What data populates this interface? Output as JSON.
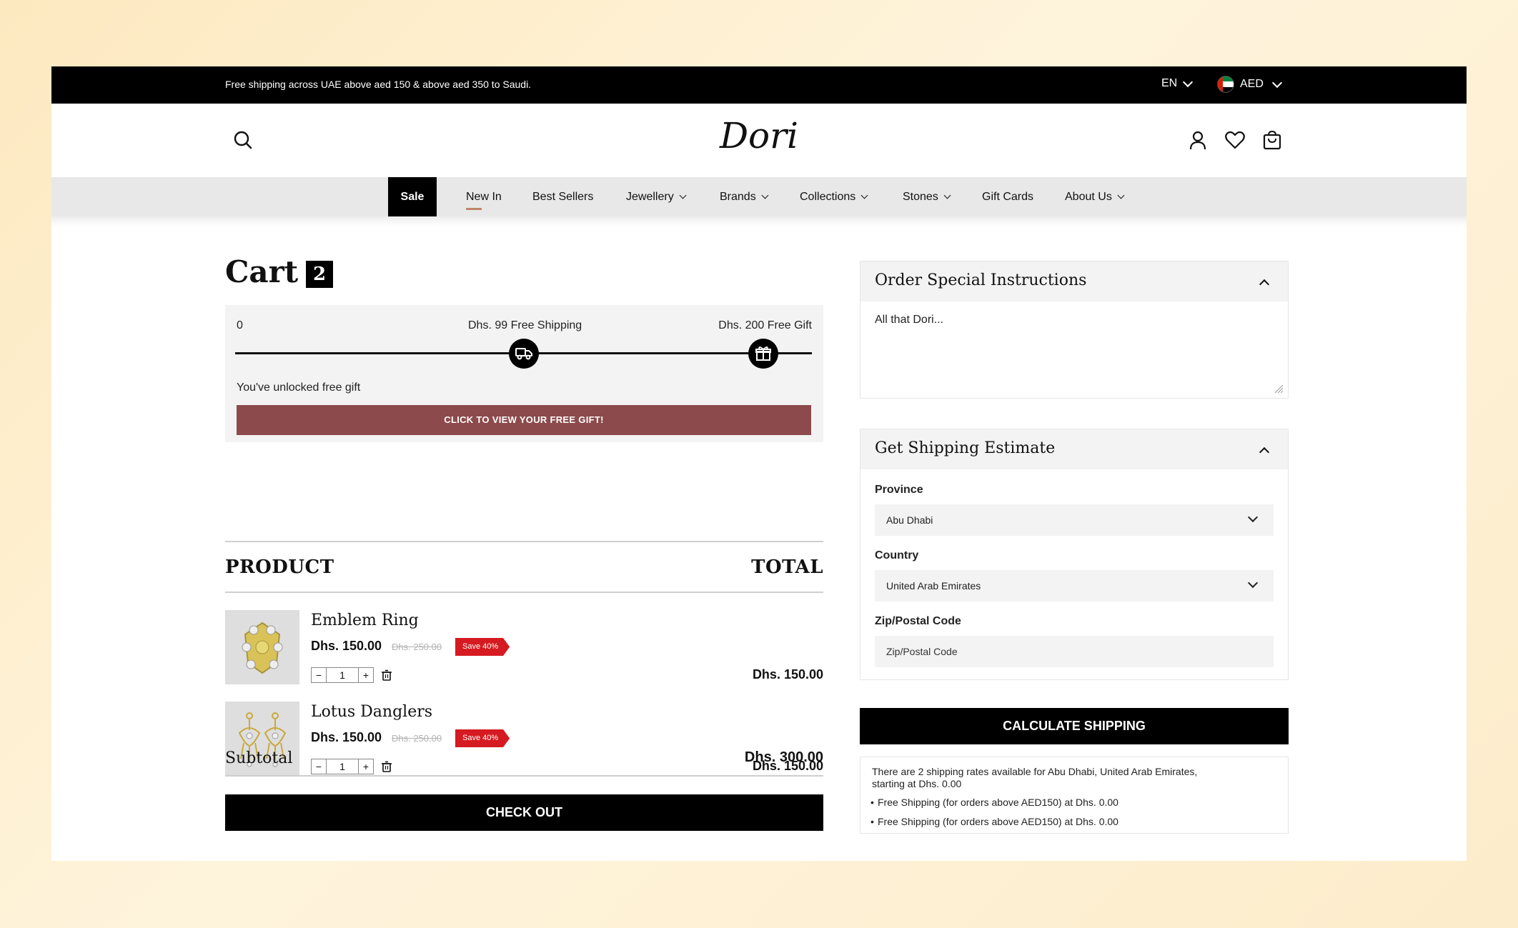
{
  "topbar": {
    "promo": "Free shipping across UAE above aed 150 & above aed 350 to Saudi.",
    "language": "EN",
    "currency": "AED"
  },
  "header": {
    "logo_text": "Dori"
  },
  "nav": {
    "items": [
      {
        "label": "Sale"
      },
      {
        "label": "New In"
      },
      {
        "label": "Best Sellers"
      },
      {
        "label": "Jewellery"
      },
      {
        "label": "Brands"
      },
      {
        "label": "Collections"
      },
      {
        "label": "Stones"
      },
      {
        "label": "Gift Cards"
      },
      {
        "label": "About Us"
      }
    ]
  },
  "cart": {
    "title": "Cart",
    "count": "2",
    "progress": {
      "start_label": "0",
      "shipping_label": "Dhs. 99 Free Shipping",
      "gift_label": "Dhs. 200 Free Gift",
      "fill_fraction": 1.0,
      "unlocked_text": "You've unlocked free gift",
      "cta_label": "CLICK TO VIEW YOUR FREE GIFT!"
    },
    "columns": {
      "product": "PRODUCT",
      "total": "TOTAL"
    },
    "items": [
      {
        "name": "Emblem Ring",
        "price": "Dhs. 150.00",
        "compare_price": "Dhs. 250.00",
        "save_badge": "Save 40%",
        "quantity": "1",
        "line_total": "Dhs. 150.00"
      },
      {
        "name": "Lotus Danglers",
        "price": "Dhs. 150.00",
        "compare_price": "Dhs. 250.00",
        "save_badge": "Save 40%",
        "quantity": "1",
        "line_total": "Dhs. 150.00"
      }
    ],
    "subtotal_label": "Subtotal",
    "subtotal_value": "Dhs. 300.00",
    "checkout_label": "CHECK OUT"
  },
  "instructions": {
    "title": "Order Special Instructions",
    "placeholder": "All that Dori..."
  },
  "shipping": {
    "title": "Get Shipping Estimate",
    "province_label": "Province",
    "province_value": "Abu Dhabi",
    "country_label": "Country",
    "country_value": "United Arab Emirates",
    "zip_label": "Zip/Postal Code",
    "zip_placeholder": "Zip/Postal Code",
    "calculate_label": "CALCULATE SHIPPING",
    "result_message": "There are 2 shipping rates available for Abu Dhabi, United Arab Emirates, starting at Dhs. 0.00",
    "rates": [
      "Free Shipping (for orders above AED150) at Dhs. 0.00",
      "Free Shipping (for orders above AED150) at Dhs. 0.00"
    ]
  },
  "colors": {
    "accent": "#8c4a4c",
    "sale_badge": "#d51b21",
    "nav_underline": "#c0866a"
  }
}
